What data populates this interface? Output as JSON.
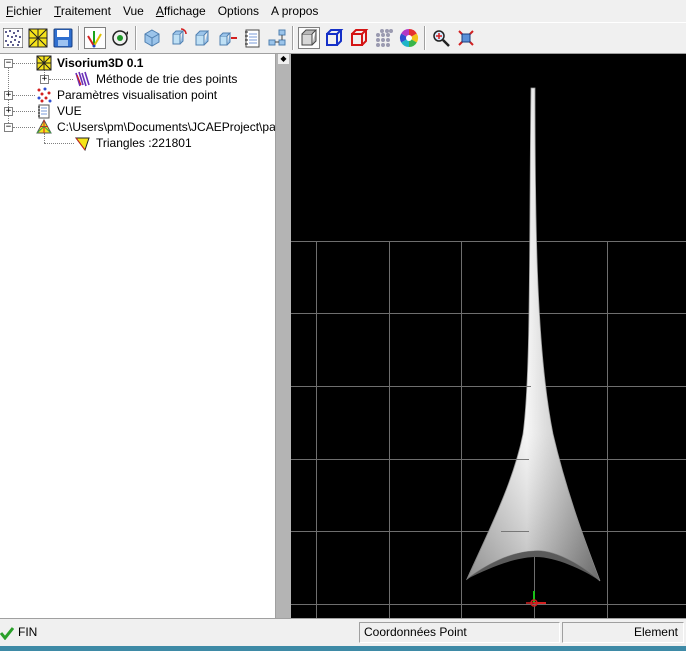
{
  "menu": {
    "items": [
      {
        "label": "Fichier",
        "underline_first": true
      },
      {
        "label": "Traitement",
        "underline_first": true
      },
      {
        "label": "Vue",
        "underline_first": false
      },
      {
        "label": "Affichage",
        "underline_first": true
      },
      {
        "label": "Options",
        "underline_first": false
      },
      {
        "label": "A propos",
        "underline_first": false
      }
    ]
  },
  "toolbar": {
    "buttons": [
      {
        "name": "point-cloud-icon"
      },
      {
        "name": "mesh-icon"
      },
      {
        "name": "save-icon"
      },
      {
        "name": "axes-icon",
        "pressed": true
      },
      {
        "name": "orbit-icon"
      },
      {
        "name": "cube-blue-icon"
      },
      {
        "name": "cube-rotate-icon"
      },
      {
        "name": "cube-translate-icon"
      },
      {
        "name": "cube-add-icon"
      },
      {
        "name": "notebook-icon"
      },
      {
        "name": "hierarchy-icon"
      },
      {
        "name": "solid-cube-icon",
        "pressed": true
      },
      {
        "name": "wire-blue-cube-icon"
      },
      {
        "name": "wire-red-cube-icon"
      },
      {
        "name": "points-cube-icon"
      },
      {
        "name": "color-wheel-icon"
      },
      {
        "name": "zoom-icon"
      },
      {
        "name": "target-icon"
      }
    ]
  },
  "tree": {
    "root_label": "Visorium3D  0.1",
    "items": [
      {
        "label": "Méthode de trie des points"
      },
      {
        "label": "Paramètres visualisation point"
      },
      {
        "label": "VUE"
      },
      {
        "label": "C:\\Users\\pm\\Documents\\JCAEProject\\pale.u"
      },
      {
        "label": "Triangles :221801"
      }
    ]
  },
  "scrollbar": {
    "left_arrow": "<",
    "right_arrow": ">"
  },
  "splitter": {
    "knob": "◆"
  },
  "status": {
    "state": "FIN",
    "coords_label": "Coordonnées Point",
    "element_label": "Element"
  },
  "colors": {
    "viewport_bg": "#000000",
    "grid": "#6e6e6e",
    "accent_strip": "#3e8aa6"
  }
}
